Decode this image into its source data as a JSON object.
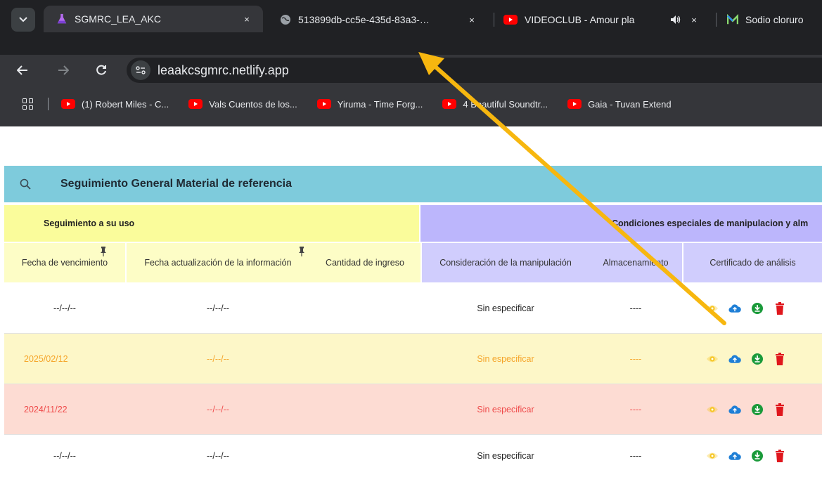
{
  "browser": {
    "tabs": [
      {
        "title": "SGMRC_LEA_AKC",
        "close": "×"
      },
      {
        "title": "513899db-cc5e-435d-83a3-…",
        "close": "×"
      },
      {
        "title": "VIDEOCLUB - Amour pla",
        "close": "×"
      },
      {
        "title": "Sodio cloruro"
      }
    ],
    "address": "leaakcsgmrc.netlify.app",
    "bookmarks": [
      {
        "label": "(1) Robert Miles - C..."
      },
      {
        "label": "Vals Cuentos de los..."
      },
      {
        "label": "Yiruma - Time Forg..."
      },
      {
        "label": "4 Beautiful Soundtr..."
      },
      {
        "label": "Gaia - Tuvan Extend"
      }
    ]
  },
  "page": {
    "title": "Seguimiento General Material de referencia",
    "groups": {
      "uso": "Seguimiento a su uso",
      "condiciones": "Condiciones especiales de manipulacion y alm"
    },
    "columns": {
      "vencimiento": "Fecha de vencimiento",
      "actualizacion": "Fecha actualización de la información",
      "cantidad": "Cantidad de ingreso",
      "manipulacion": "Consideración de la manipulación",
      "almacenamiento": "Almacenamiento",
      "certificado": "Certificado de análisis"
    },
    "rows": [
      {
        "vencimiento": "--/--/--",
        "actualizacion": "--/--/--",
        "manipulacion": "Sin especificar",
        "almacenamiento": "----",
        "status": "normal"
      },
      {
        "vencimiento": "2025/02/12",
        "actualizacion": "--/--/--",
        "manipulacion": "Sin especificar",
        "almacenamiento": "----",
        "status": "warning"
      },
      {
        "vencimiento": "2024/11/22",
        "actualizacion": "--/--/--",
        "manipulacion": "Sin especificar",
        "almacenamiento": "----",
        "status": "expired"
      },
      {
        "vencimiento": "--/--/--",
        "actualizacion": "--/--/--",
        "manipulacion": "Sin especificar",
        "almacenamiento": "----",
        "status": "normal"
      }
    ]
  },
  "colors": {
    "title_band": "#7ecbdc",
    "group_uso": "#fafc9b",
    "group_condiciones": "#bcb6fc",
    "row_warning_bg": "#fdf7c8",
    "row_warning_text": "#f5a52a",
    "row_expired_bg": "#fddcd3",
    "row_expired_text": "#ef4a4a",
    "annotation_arrow": "#f7b70f",
    "icon_view": "#f6c623",
    "icon_upload": "#1f7fd6",
    "icon_download": "#1a9a3a",
    "icon_delete": "#e0171d"
  },
  "icons": {
    "view": "eye-icon",
    "upload": "cloud-upload-icon",
    "download": "download-circle-icon",
    "delete": "trash-icon"
  }
}
